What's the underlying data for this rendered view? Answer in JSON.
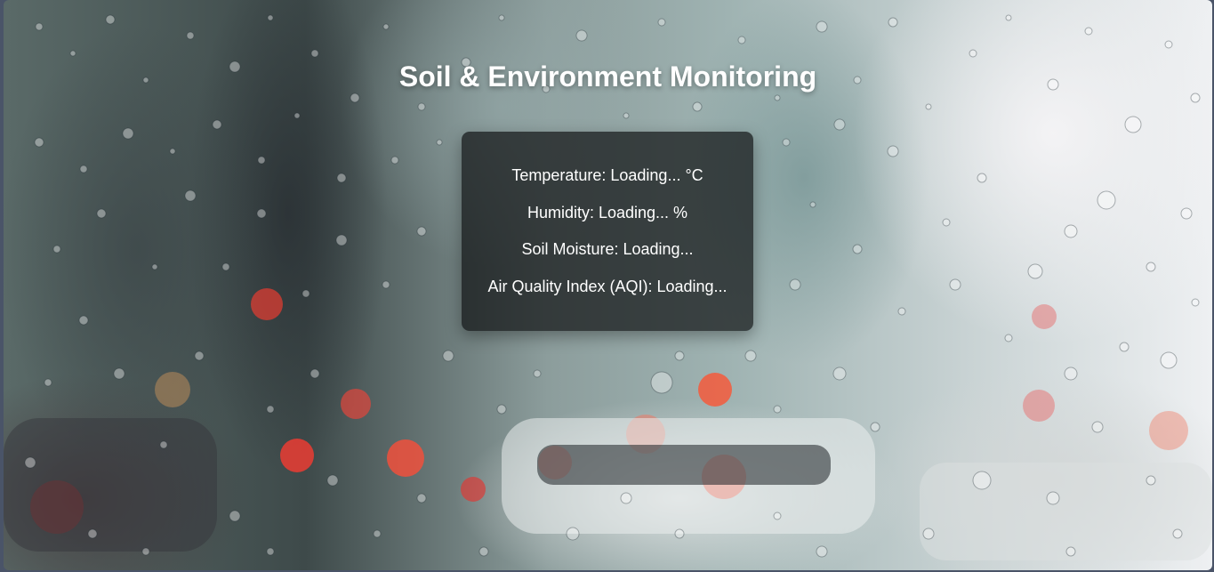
{
  "page": {
    "title": "Soil & Environment Monitoring"
  },
  "readings": {
    "temperature": "Temperature: Loading... °C",
    "humidity": "Humidity: Loading... %",
    "soil_moisture": "Soil Moisture: Loading...",
    "aqi": "Air Quality Index (AQI): Loading..."
  },
  "colors": {
    "card_background": "#0a0c0e",
    "text": "#ffffff",
    "page_frame": "#4a5468"
  }
}
